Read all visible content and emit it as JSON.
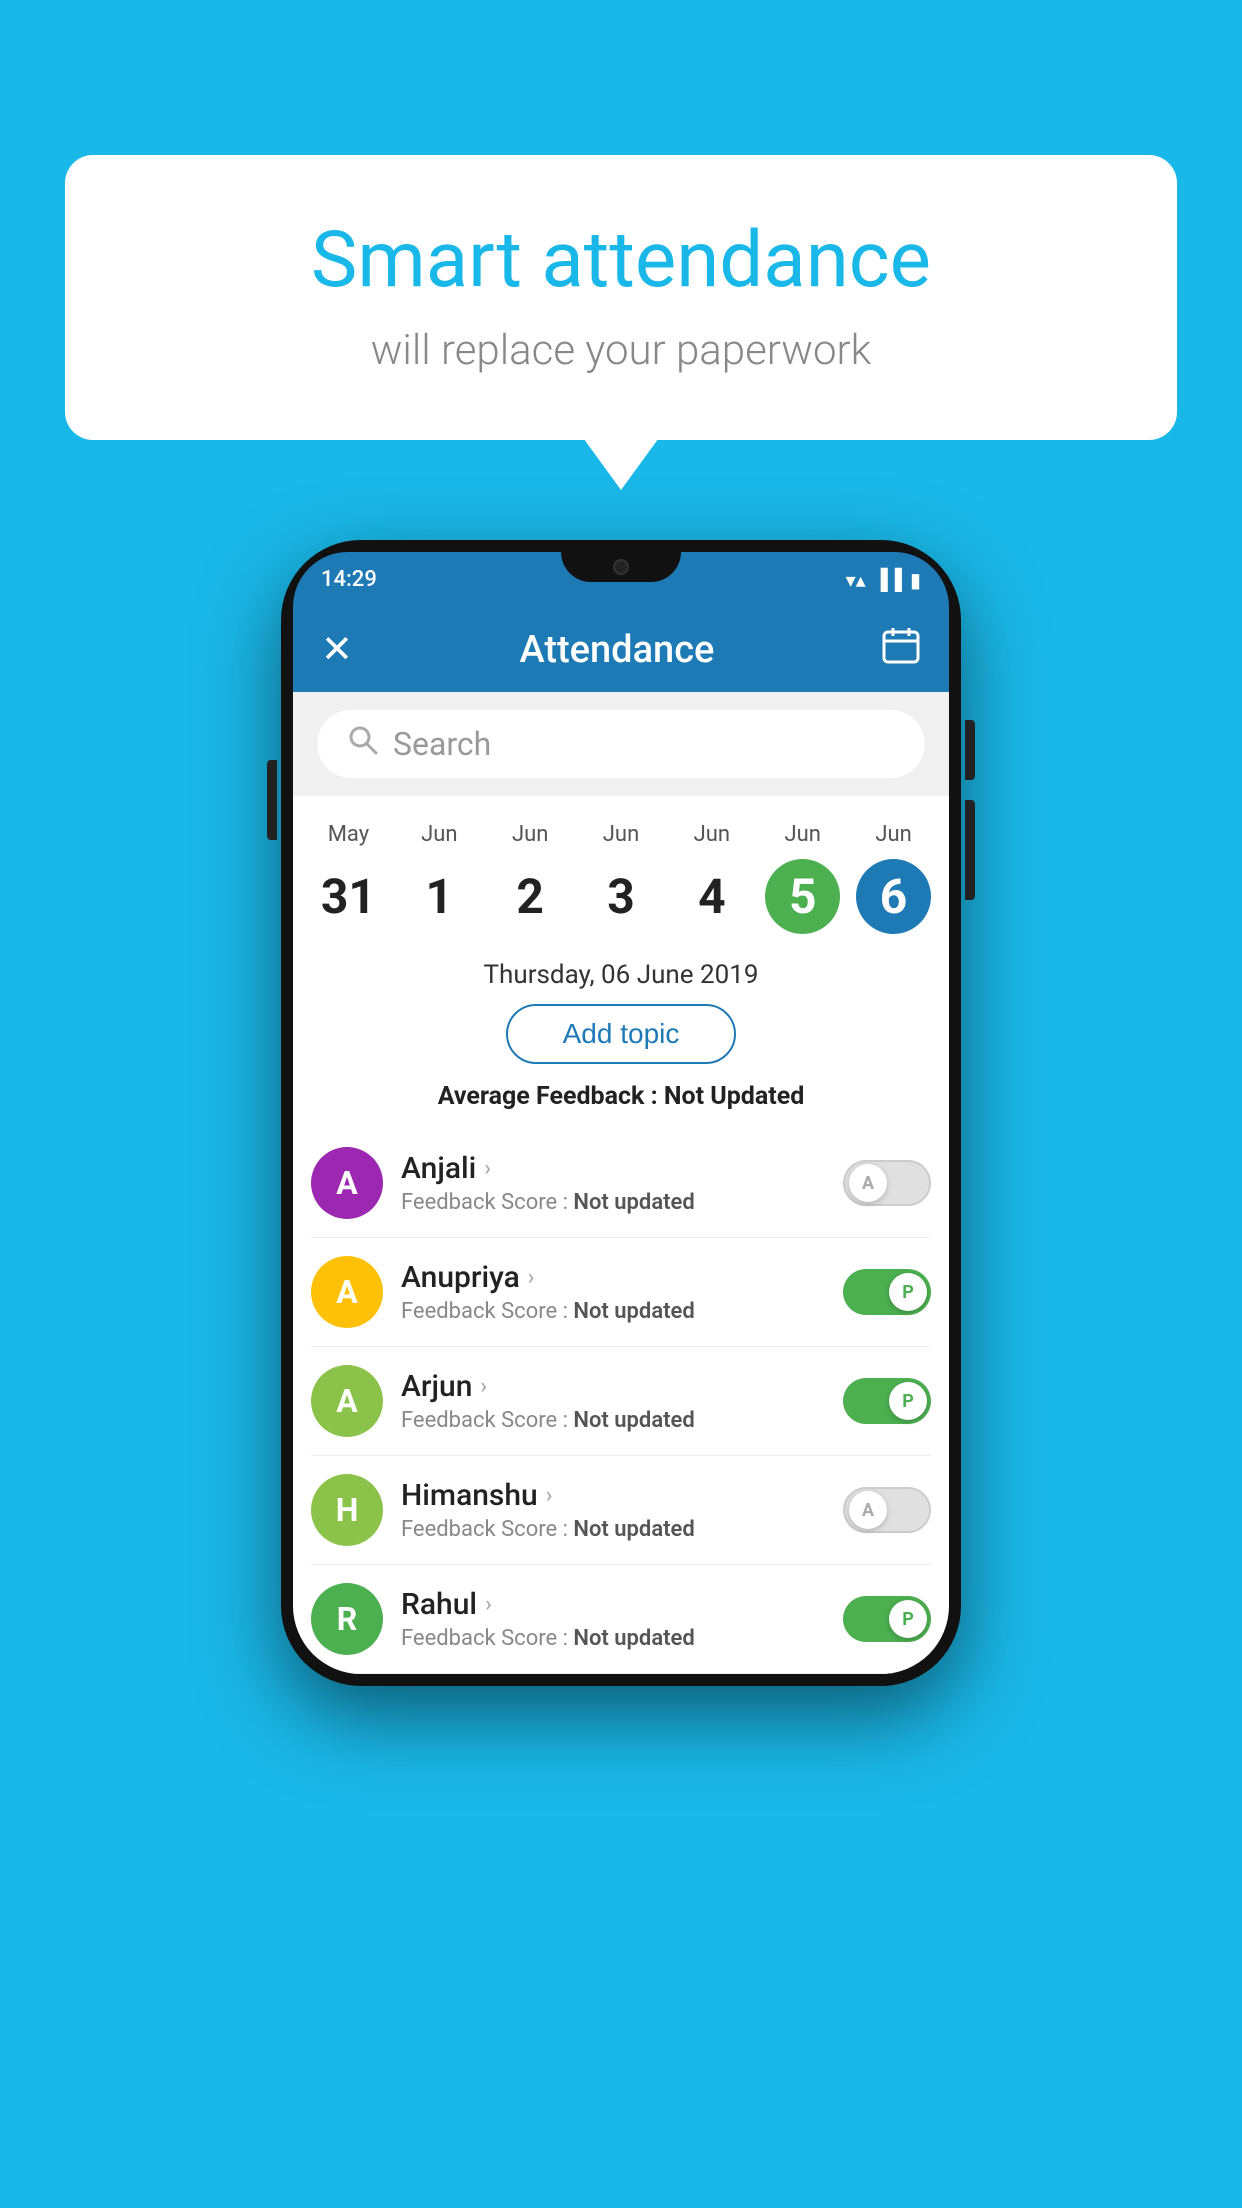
{
  "background_color": "#1ab8e8",
  "speech_bubble": {
    "title": "Smart attendance",
    "subtitle": "will replace your paperwork"
  },
  "phone": {
    "status_bar": {
      "time": "14:29",
      "icons": [
        "wifi",
        "signal",
        "battery"
      ]
    },
    "app_bar": {
      "title": "Attendance",
      "close_icon": "✕",
      "calendar_icon": "📅"
    },
    "search": {
      "placeholder": "Search"
    },
    "date_columns": [
      {
        "month": "May",
        "day": "31",
        "active": false
      },
      {
        "month": "Jun",
        "day": "1",
        "active": false
      },
      {
        "month": "Jun",
        "day": "2",
        "active": false
      },
      {
        "month": "Jun",
        "day": "3",
        "active": false
      },
      {
        "month": "Jun",
        "day": "4",
        "active": false
      },
      {
        "month": "Jun",
        "day": "5",
        "active": "green"
      },
      {
        "month": "Jun",
        "day": "6",
        "active": "blue"
      }
    ],
    "selected_date": "Thursday, 06 June 2019",
    "add_topic_label": "Add topic",
    "avg_feedback_label": "Average Feedback : ",
    "avg_feedback_value": "Not Updated",
    "students": [
      {
        "name": "Anjali",
        "avatar_letter": "A",
        "avatar_color": "#9c27b0",
        "feedback_label": "Feedback Score : ",
        "feedback_value": "Not updated",
        "toggle": "off",
        "toggle_letter": "A"
      },
      {
        "name": "Anupriya",
        "avatar_letter": "A",
        "avatar_color": "#ffc107",
        "feedback_label": "Feedback Score : ",
        "feedback_value": "Not updated",
        "toggle": "on",
        "toggle_letter": "P"
      },
      {
        "name": "Arjun",
        "avatar_letter": "A",
        "avatar_color": "#8bc34a",
        "feedback_label": "Feedback Score : ",
        "feedback_value": "Not updated",
        "toggle": "on",
        "toggle_letter": "P"
      },
      {
        "name": "Himanshu",
        "avatar_letter": "H",
        "avatar_color": "#8bc34a",
        "feedback_label": "Feedback Score : ",
        "feedback_value": "Not updated",
        "toggle": "off",
        "toggle_letter": "A"
      },
      {
        "name": "Rahul",
        "avatar_letter": "R",
        "avatar_color": "#4caf50",
        "feedback_label": "Feedback Score : ",
        "feedback_value": "Not updated",
        "toggle": "on",
        "toggle_letter": "P"
      }
    ]
  }
}
